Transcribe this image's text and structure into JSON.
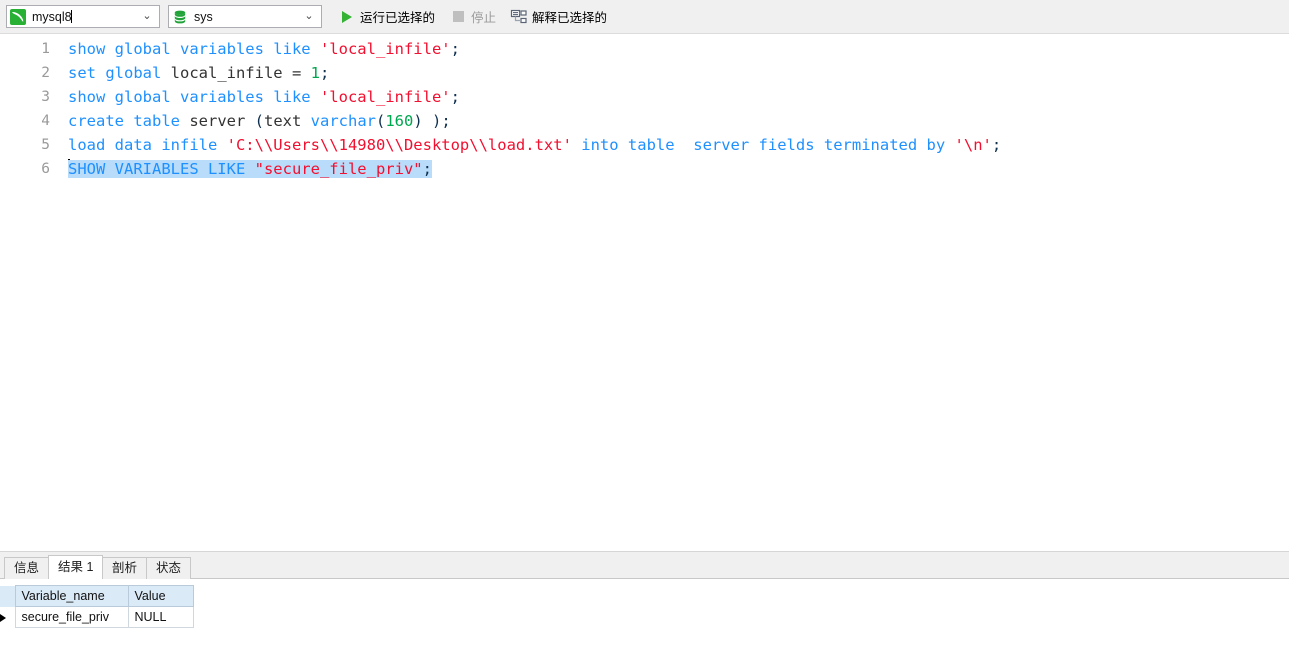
{
  "toolbar": {
    "connection": {
      "icon": "mysql-dolphin-icon",
      "label": "mysql8",
      "arrow": "⌄"
    },
    "schema": {
      "icon": "database-icon",
      "label": "sys",
      "arrow": "⌄"
    },
    "buttons": [
      {
        "name": "run-selected",
        "icon": "play-triangle-icon",
        "label": "运行已选择的",
        "enabled": true
      },
      {
        "name": "stop",
        "icon": "stop-square-icon",
        "label": "停止",
        "enabled": false
      },
      {
        "name": "explain-selected",
        "icon": "explain-plan-icon",
        "label": "解释已选择的",
        "enabled": true
      }
    ]
  },
  "editor": {
    "line_numbers": [
      "1",
      "2",
      "3",
      "4",
      "5",
      "6"
    ],
    "lines": [
      {
        "number": "1",
        "text": "show global variables like 'local_infile';",
        "tokens": [
          {
            "t": "show global variables like ",
            "c": "kw"
          },
          {
            "t": "'local_infile'",
            "c": "str"
          },
          {
            "t": ";",
            "c": "punc"
          }
        ]
      },
      {
        "number": "2",
        "text": "set global local_infile = 1;",
        "tokens": [
          {
            "t": "set global ",
            "c": "kw"
          },
          {
            "t": "local_infile ",
            "c": "id"
          },
          {
            "t": "= ",
            "c": "op"
          },
          {
            "t": "1",
            "c": "num"
          },
          {
            "t": ";",
            "c": "punc"
          }
        ]
      },
      {
        "number": "3",
        "text": "show global variables like 'local_infile';",
        "tokens": [
          {
            "t": "show global variables like ",
            "c": "kw"
          },
          {
            "t": "'local_infile'",
            "c": "str"
          },
          {
            "t": ";",
            "c": "punc"
          }
        ]
      },
      {
        "number": "4",
        "text": "create table server (text varchar(160) );",
        "tokens": [
          {
            "t": "create table ",
            "c": "kw"
          },
          {
            "t": "server ",
            "c": "id"
          },
          {
            "t": "(",
            "c": "punc"
          },
          {
            "t": "text ",
            "c": "id"
          },
          {
            "t": "varchar",
            "c": "kw"
          },
          {
            "t": "(",
            "c": "punc"
          },
          {
            "t": "160",
            "c": "num"
          },
          {
            "t": ") );",
            "c": "punc"
          }
        ]
      },
      {
        "number": "5",
        "text": "load data infile 'C:\\\\Users\\\\14980\\\\Desktop\\\\load.txt' into table  server fields terminated by '\\n';",
        "tokens": [
          {
            "t": "load data infile ",
            "c": "kw"
          },
          {
            "t": "'C:\\\\Users\\\\14980\\\\Desktop\\\\load.txt' ",
            "c": "str"
          },
          {
            "t": "into table  server fields terminated by ",
            "c": "kw"
          },
          {
            "t": "'\\n'",
            "c": "str"
          },
          {
            "t": ";",
            "c": "punc"
          }
        ]
      },
      {
        "number": "6",
        "selected": true,
        "text": "SHOW VARIABLES LIKE \"secure_file_priv\";",
        "tokens": [
          {
            "t": "SHOW VARIABLES LIKE ",
            "c": "kw"
          },
          {
            "t": "\"secure_file_priv\"",
            "c": "str"
          },
          {
            "t": ";",
            "c": "punc"
          }
        ]
      }
    ]
  },
  "results": {
    "tabs": [
      {
        "label": "信息",
        "active": false
      },
      {
        "label": "结果 1",
        "active": true
      },
      {
        "label": "剖析",
        "active": false
      },
      {
        "label": "状态",
        "active": false
      }
    ],
    "grid": {
      "columns": [
        "Variable_name",
        "Value"
      ],
      "rows": [
        {
          "marker": "current-row-marker",
          "cells": [
            "secure_file_priv",
            "NULL"
          ]
        }
      ]
    }
  },
  "colors": {
    "keyword": "#1e90ff",
    "string": "#f20f2f",
    "number": "#00a64f",
    "punctuation": "#103050",
    "selection": "#b9dcfa",
    "toolbar_bg": "#f0f0f0",
    "grid_header_bg": "#dbeaf7",
    "accent_green": "#27b034"
  }
}
